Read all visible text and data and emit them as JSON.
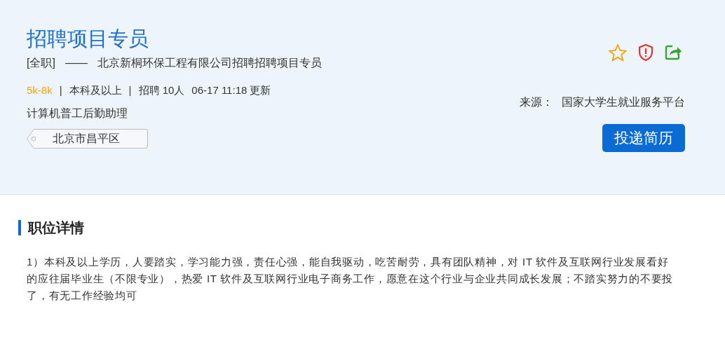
{
  "job": {
    "title": "招聘项目专员",
    "type": "[全职]",
    "dash": "——",
    "company": "北京新桐环保工程有限公司招聘招聘项目专员",
    "salary": "5k-8k",
    "sep1": "|",
    "education": "本科及以上",
    "sep2": "|",
    "headcount": "招聘 10人",
    "updated": "06-17 11:18 更新",
    "category": "计算机普工后勤助理",
    "location": "北京市昌平区",
    "favorited": false,
    "source_label": "来源：",
    "source": "国家大学生就业服务平台",
    "apply_button": "投递简历"
  },
  "details": {
    "heading": "职位详情",
    "text": "1）本科及以上学历，人要踏实，学习能力强，责任心强，能自我驱动，吃苦耐劳，具有团队精神，对 IT 软件及互联网行业发展看好的应往届毕业生（不限专业），热爱 IT 软件及互联网行业电子商务工作，愿意在这个行业与企业共同成长发展；不踏实努力的不要投了，有无工作经验均可"
  }
}
